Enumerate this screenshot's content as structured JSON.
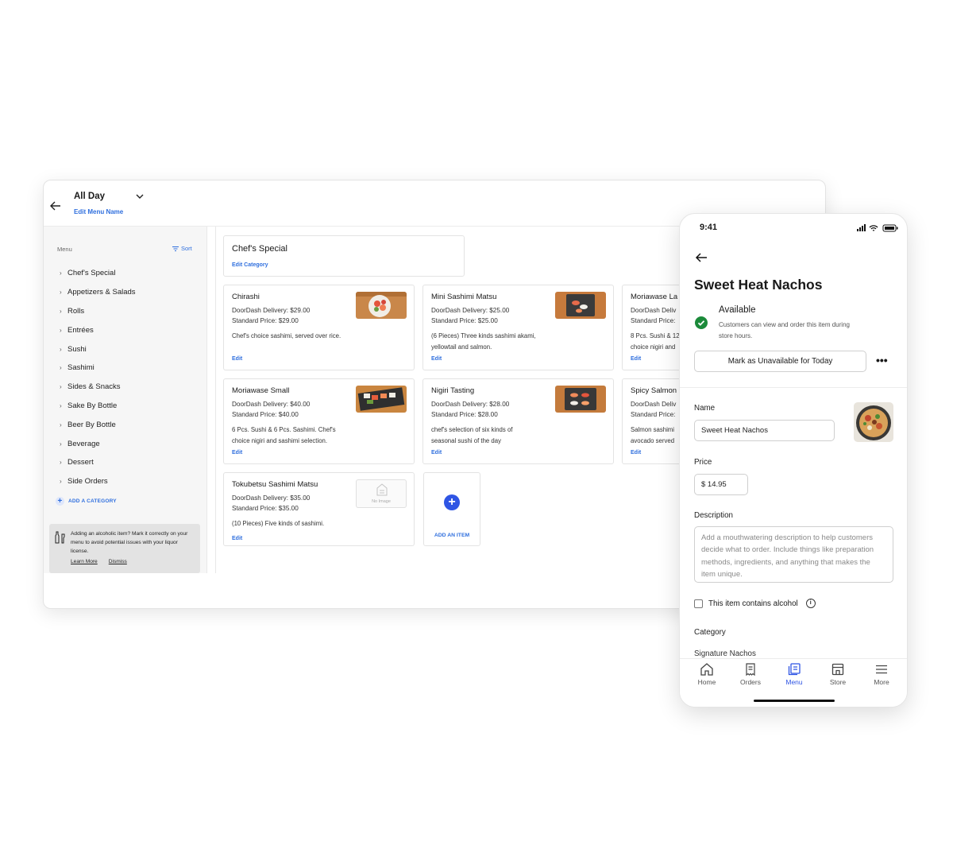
{
  "desktop": {
    "menu_title": "All Day",
    "edit_menu_name": "Edit Menu Name",
    "sidebar": {
      "heading": "Menu",
      "sort_label": "Sort",
      "categories": [
        "Chef's Special",
        "Appetizers & Salads",
        "Rolls",
        "Entrées",
        "Sushi",
        "Sashimi",
        "Sides & Snacks",
        "Sake By Bottle",
        "Beer By Bottle",
        "Beverage",
        "Dessert",
        "Side Orders"
      ],
      "add_category": "ADD A CATEGORY",
      "alert": {
        "text": "Adding an alcoholic item? Mark it correctly on your menu to avoid potential issues with your liquor license.",
        "learn_more": "Learn More",
        "dismiss": "Dismiss"
      }
    },
    "category": {
      "title": "Chef's Special",
      "edit": "Edit Category"
    },
    "items": [
      {
        "name": "Chirashi",
        "delivery": "DoorDash Delivery: $29.00",
        "standard": "Standard Price: $29.00",
        "description": "Chef's choice sashimi, served over rice.",
        "edit": "Edit"
      },
      {
        "name": "Mini Sashimi Matsu",
        "delivery": "DoorDash Delivery: $25.00",
        "standard": "Standard Price: $25.00",
        "description": "(6 Pieces) Three kinds sashimi akami, yellowtail and salmon.",
        "edit": "Edit"
      },
      {
        "name": "Moriawase La",
        "delivery": "DoorDash Deliv",
        "standard": "Standard Price:",
        "description": "8 Pcs. Sushi & 12 choice nigiri and",
        "edit": "Edit"
      },
      {
        "name": "Moriawase Small",
        "delivery": "DoorDash Delivery: $40.00",
        "standard": "Standard Price: $40.00",
        "description": "6 Pcs. Sushi & 6 Pcs. Sashimi. Chef's choice nigiri and sashimi selection.",
        "edit": "Edit"
      },
      {
        "name": "Nigiri Tasting",
        "delivery": "DoorDash Delivery: $28.00",
        "standard": "Standard Price: $28.00",
        "description": "chef's selection of six kinds of seasonal sushi of the day",
        "edit": "Edit"
      },
      {
        "name": "Spicy Salmon",
        "delivery": "DoorDash Deliv",
        "standard": "Standard Price:",
        "description": "Salmon sashimi avocado served",
        "edit": "Edit"
      },
      {
        "name": "Tokubetsu Sashimi Matsu",
        "delivery": "DoorDash Delivery: $35.00",
        "standard": "Standard Price: $35.00",
        "description": "(10 Pieces) Five kinds of sashimi.",
        "edit": "Edit",
        "no_image": "No Image"
      }
    ],
    "add_item": "ADD AN ITEM"
  },
  "phone": {
    "time": "9:41",
    "title": "Sweet Heat Nachos",
    "status": "Available",
    "status_sub": "Customers can view and order this item during store hours.",
    "mark_button": "Mark as Unavailable for Today",
    "more": "•••",
    "name_label": "Name",
    "name_value": "Sweet Heat Nachos",
    "price_label": "Price",
    "price_value": "$ 14.95",
    "description_label": "Description",
    "description_placeholder": "Add a mouthwatering description to help customers decide what to order. Include things like preparation methods, ingredients, and anything that makes the item unique.",
    "alcohol_label": "This item contains alcohol",
    "category_label": "Category",
    "category_value": "Signature Nachos",
    "tabs": [
      {
        "label": "Home",
        "icon": "home-icon"
      },
      {
        "label": "Orders",
        "icon": "receipt-icon"
      },
      {
        "label": "Menu",
        "icon": "menu-book-icon",
        "active": true
      },
      {
        "label": "Store",
        "icon": "store-icon"
      },
      {
        "label": "More",
        "icon": "hamburger-icon"
      }
    ]
  },
  "colors": {
    "accent_blue": "#2f6fde",
    "available_green": "#1b8a3a"
  }
}
